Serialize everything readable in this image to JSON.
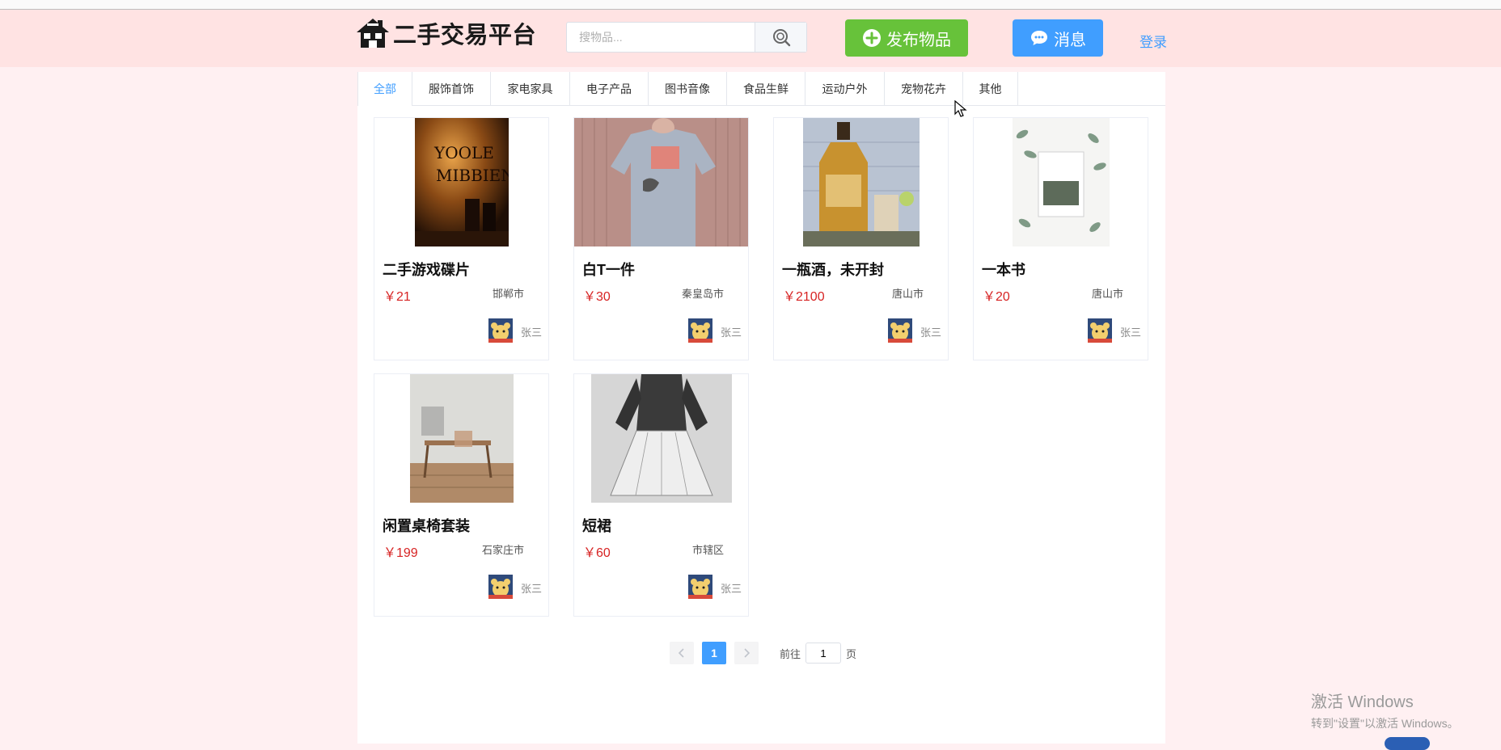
{
  "header": {
    "logo_text": "二手交易平台",
    "search_placeholder": "搜物品...",
    "publish_label": "发布物品",
    "message_label": "消息",
    "login_label": "登录"
  },
  "tabs": [
    {
      "label": "全部",
      "active": true
    },
    {
      "label": "服饰首饰"
    },
    {
      "label": "家电家具"
    },
    {
      "label": "电子产品"
    },
    {
      "label": "图书音像"
    },
    {
      "label": "食品生鲜"
    },
    {
      "label": "运动户外"
    },
    {
      "label": "宠物花卉"
    },
    {
      "label": "其他"
    }
  ],
  "products": [
    {
      "title": "二手游戏碟片",
      "price": "￥21",
      "city": "邯郸市",
      "seller": "张三"
    },
    {
      "title": "白T一件",
      "price": "￥30",
      "city": "秦皇岛市",
      "seller": "张三"
    },
    {
      "title": "一瓶酒，未开封",
      "price": "￥2100",
      "city": "唐山市",
      "seller": "张三"
    },
    {
      "title": "一本书",
      "price": "￥20",
      "city": "唐山市",
      "seller": "张三"
    },
    {
      "title": "闲置桌椅套装",
      "price": "￥199",
      "city": "石家庄市",
      "seller": "张三"
    },
    {
      "title": "短裙",
      "price": "￥60",
      "city": "市辖区",
      "seller": "张三"
    }
  ],
  "pagination": {
    "current_page": "1",
    "goto_prefix": "前往",
    "goto_value": "1",
    "goto_suffix": "页"
  },
  "watermark": {
    "line1": "激活 Windows",
    "line2": "转到\"设置\"以激活 Windows。"
  },
  "colors": {
    "header_bg": "#ffe3e3",
    "page_bg": "#fff0f2",
    "publish_green": "#67c23a",
    "primary_blue": "#409eff",
    "price_red": "#d72323"
  }
}
